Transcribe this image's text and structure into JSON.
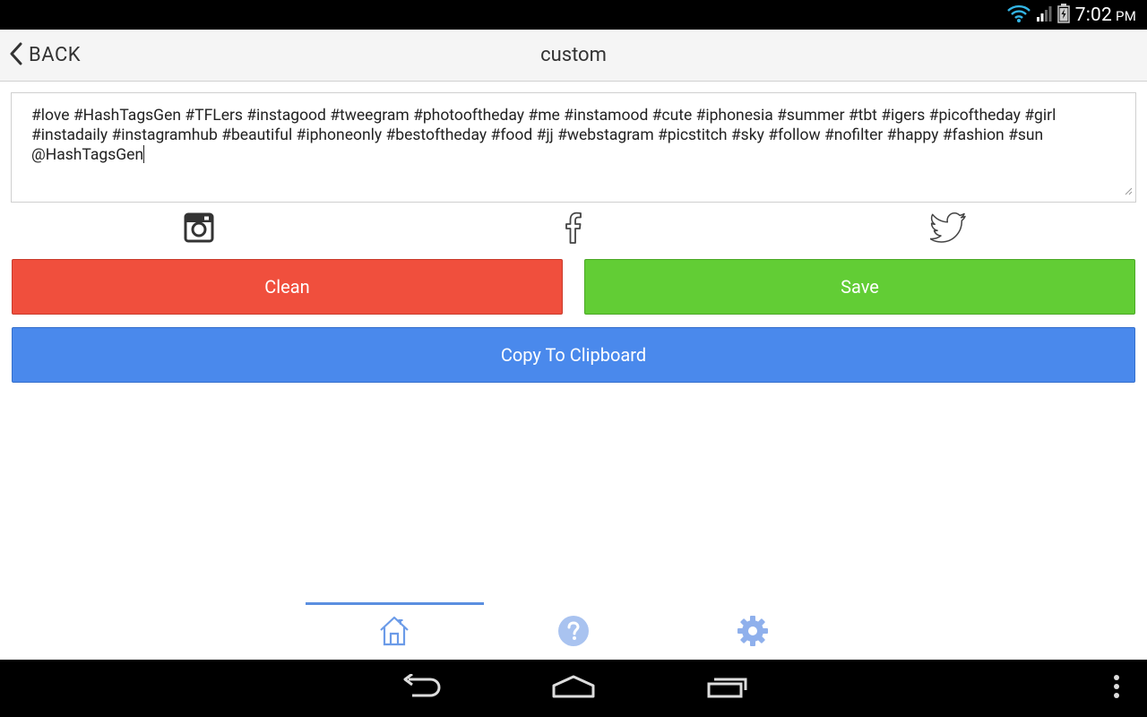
{
  "status_bar": {
    "time": "7:02",
    "ampm": "PM",
    "icons": [
      "wifi-icon",
      "signal-icon",
      "battery-icon"
    ]
  },
  "header": {
    "back_label": "BACK",
    "title": "custom"
  },
  "editor": {
    "text": "#love #HashTagsGen #TFLers #instagood #tweegram #photooftheday #me #instamood #cute #iphonesia #summer #tbt #igers #picoftheday #girl #instadaily #instagramhub #beautiful #iphoneonly #bestoftheday #food #jj #webstagram #picstitch #sky #follow #nofilter #happy #fashion #sun @HashTagsGen"
  },
  "share": {
    "icons": [
      "instagram-icon",
      "facebook-icon",
      "twitter-icon"
    ]
  },
  "buttons": {
    "clean_label": "Clean",
    "save_label": "Save",
    "copy_label": "Copy To Clipboard"
  },
  "tabs": {
    "items": [
      "home-icon",
      "help-icon",
      "settings-icon"
    ],
    "active": "home-icon"
  },
  "colors": {
    "clean": "#f04f3d",
    "save": "#62cd35",
    "copy": "#4a89ec",
    "tab_accent": "#5b8fe0"
  }
}
